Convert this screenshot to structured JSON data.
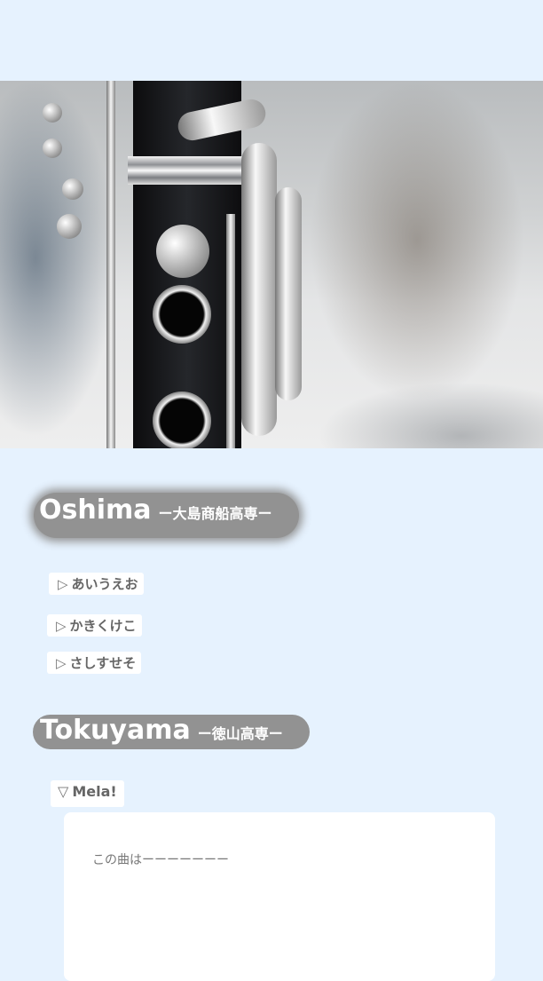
{
  "hero": {
    "image": "clarinet-photo"
  },
  "sections": [
    {
      "title": "Oshima",
      "subtitle": "ー大島商船高専ー",
      "items": [
        {
          "icon": "triangle-right-icon",
          "marker": "▷",
          "label": "あいうえお"
        },
        {
          "icon": "triangle-right-icon",
          "marker": "▷",
          "label": "かきくけこ"
        },
        {
          "icon": "triangle-right-icon",
          "marker": "▷",
          "label": "さしすせそ"
        }
      ]
    },
    {
      "title": "Tokuyama",
      "subtitle": "ー徳山高専ー",
      "items": [
        {
          "icon": "triangle-down-icon",
          "marker": "▽",
          "label": "Mela!",
          "expanded": true,
          "content": "この曲はーーーーーーー"
        }
      ]
    }
  ],
  "colors": {
    "background": "#e6f2fe",
    "pill": "#929292",
    "text": "#666666"
  }
}
